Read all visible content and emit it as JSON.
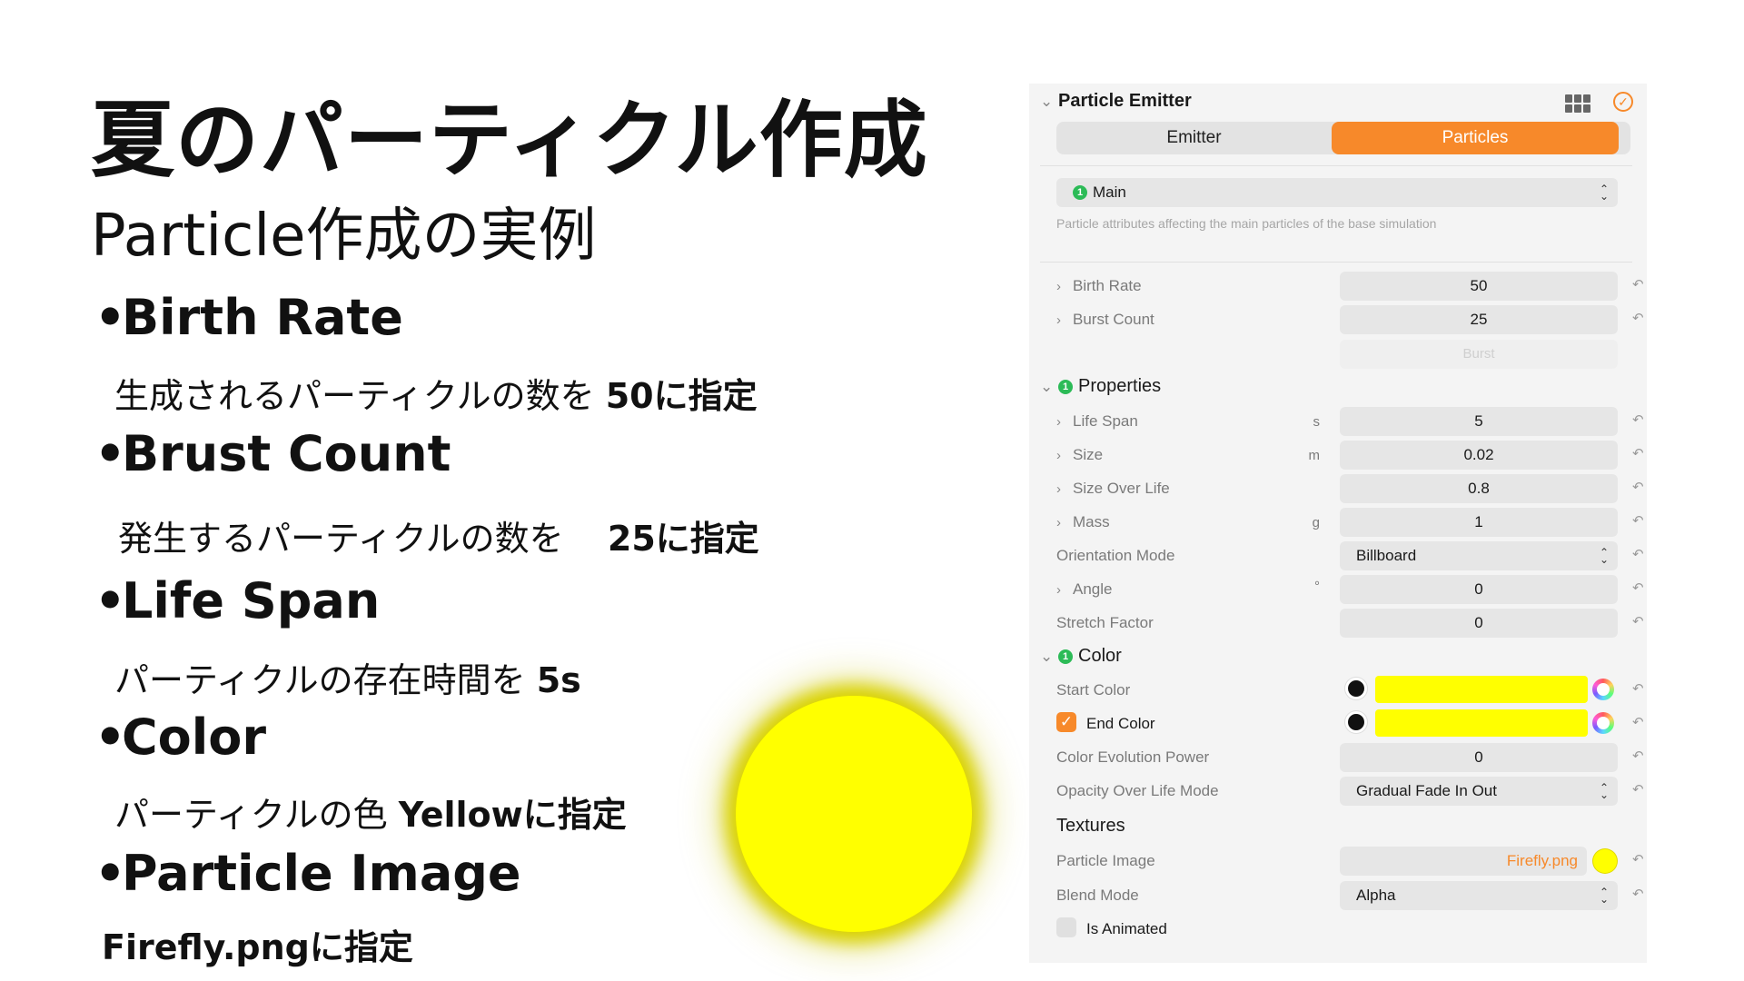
{
  "slide": {
    "title": "夏のパーティクル作成",
    "subtitle": "Particle作成の実例",
    "bullet_symbol": "•",
    "items": [
      {
        "heading": "Birth Rate",
        "desc_text": "生成されるパーティクルの数を",
        "desc_value": "50に指定"
      },
      {
        "heading": "Brust Count",
        "desc_text": "発生するパーティクルの数を",
        "desc_value": "25に指定"
      },
      {
        "heading": "Life Span",
        "desc_text": "パーティクルの存在時間を",
        "desc_value": "5s"
      },
      {
        "heading": "Color",
        "desc_text": "パーティクルの色",
        "desc_value": "Yellowに指定"
      },
      {
        "heading": "Particle Image",
        "desc_text": "",
        "desc_value": "Firefly.pngに指定"
      }
    ],
    "sun_color": "#ffff00"
  },
  "panel": {
    "title": "Particle Emitter",
    "tabs": [
      {
        "label": "Emitter",
        "active": false
      },
      {
        "label": "Particles",
        "active": true
      }
    ],
    "accent_color": "#f7892a",
    "main_select": {
      "badge": "1",
      "value": "Main"
    },
    "main_caption": "Particle attributes affecting the main particles of the base simulation",
    "birth_rate": {
      "label": "Birth Rate",
      "value": "50"
    },
    "burst_count": {
      "label": "Burst Count",
      "value": "25"
    },
    "burst_button": "Burst",
    "properties": {
      "header": "Properties",
      "badge": "1",
      "rows": [
        {
          "label": "Life Span",
          "unit": "s",
          "value": "5"
        },
        {
          "label": "Size",
          "unit": "m",
          "value": "0.02"
        },
        {
          "label": "Size Over Life",
          "unit": "",
          "value": "0.8"
        },
        {
          "label": "Mass",
          "unit": "g",
          "value": "1"
        }
      ],
      "orientation_mode": {
        "label": "Orientation Mode",
        "value": "Billboard"
      },
      "angle": {
        "label": "Angle",
        "unit": "°",
        "value": "0"
      },
      "stretch_factor": {
        "label": "Stretch Factor",
        "value": "0"
      }
    },
    "color": {
      "header": "Color",
      "badge": "1",
      "start_color": {
        "label": "Start Color",
        "color": "#ffff00"
      },
      "end_color": {
        "label": "End Color",
        "checked": true,
        "color": "#ffff00"
      },
      "evolution_power": {
        "label": "Color Evolution Power",
        "value": "0"
      },
      "opacity_mode": {
        "label": "Opacity Over Life Mode",
        "value": "Gradual Fade In Out"
      }
    },
    "textures": {
      "header": "Textures",
      "particle_image": {
        "label": "Particle Image",
        "value": "Firefly.png"
      },
      "blend_mode": {
        "label": "Blend Mode",
        "value": "Alpha"
      },
      "is_animated": {
        "label": "Is Animated",
        "checked": false
      }
    }
  }
}
